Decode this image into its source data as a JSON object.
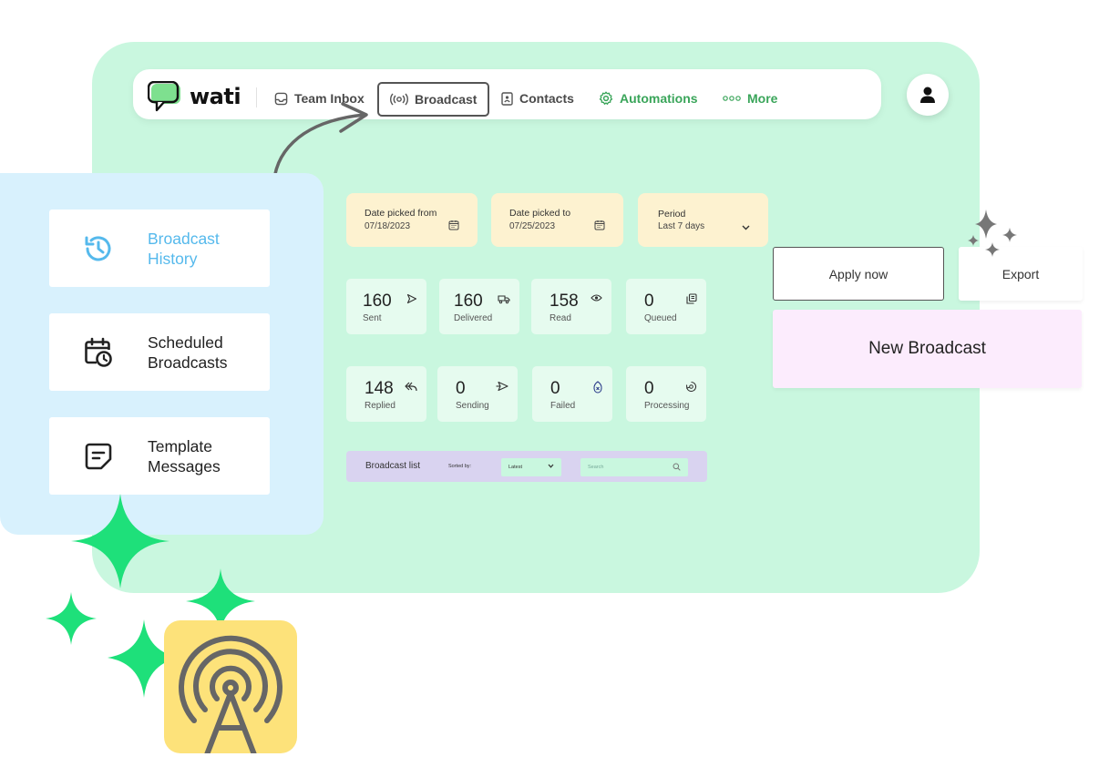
{
  "brand": {
    "name": "wati",
    "accent": "#3aa55a",
    "panel_bg": "#c9f7df"
  },
  "nav": {
    "items": [
      {
        "label": "Team Inbox",
        "icon": "inbox-icon"
      },
      {
        "label": "Broadcast",
        "icon": "broadcast-icon",
        "active": true
      },
      {
        "label": "Contacts",
        "icon": "contacts-icon"
      },
      {
        "label": "Automations",
        "icon": "gear-icon"
      },
      {
        "label": "More",
        "icon": "dots-icon"
      }
    ]
  },
  "sidebar": {
    "items": [
      {
        "label": "Broadcast History",
        "icon": "history-icon",
        "active": true
      },
      {
        "label": "Scheduled Broadcasts",
        "icon": "calendar-clock-icon"
      },
      {
        "label": "Template Messages",
        "icon": "message-template-icon"
      }
    ]
  },
  "filters": {
    "date_from": {
      "label": "Date picked from",
      "value": "07/18/2023"
    },
    "date_to": {
      "label": "Date picked to",
      "value": "07/25/2023"
    },
    "period": {
      "label": "Period",
      "value": "Last 7 days"
    }
  },
  "stats": [
    {
      "value": "160",
      "label": "Sent",
      "icon": "send-icon"
    },
    {
      "value": "160",
      "label": "Delivered",
      "icon": "delivery-icon"
    },
    {
      "value": "158",
      "label": "Read",
      "icon": "eye-icon"
    },
    {
      "value": "0",
      "label": "Queued",
      "icon": "queue-icon"
    },
    {
      "value": "148",
      "label": "Replied",
      "icon": "reply-icon"
    },
    {
      "value": "0",
      "label": "Sending",
      "icon": "sending-icon"
    },
    {
      "value": "0",
      "label": "Failed",
      "icon": "failed-icon"
    },
    {
      "value": "0",
      "label": "Processing",
      "icon": "processing-icon"
    }
  ],
  "broadcast_list": {
    "title": "Broadcast list",
    "sort_label": "Sorted by:",
    "sort_value": "Latest",
    "search_placeholder": "Search"
  },
  "actions": {
    "apply_label": "Apply now",
    "export_label": "Export",
    "new_broadcast_label": "New Broadcast"
  }
}
